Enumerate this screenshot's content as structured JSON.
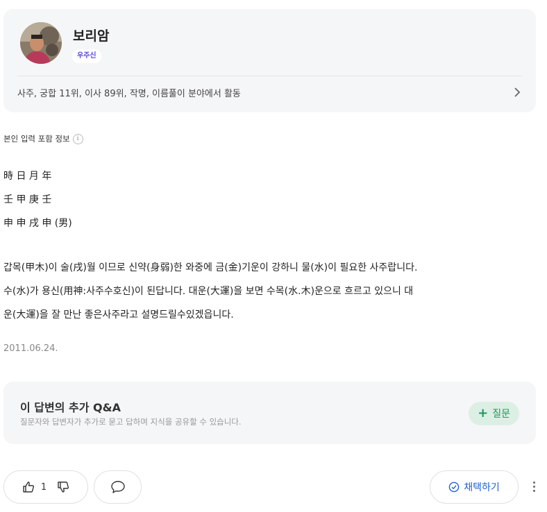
{
  "profile": {
    "name": "보리암",
    "grade_badge": "우주신",
    "description": "사주, 궁합 11위, 이사 89위, 작명, 이름풀이 분야에서 활동"
  },
  "answer": {
    "info_label": "본인 입력 포함 정보",
    "info_icon_glyph": "i",
    "lines": [
      "時 日 月 年",
      "壬 甲 庚 壬",
      "申 申 戌 申 (男)"
    ],
    "paragraph": [
      "갑목(甲木)이 술(戌)월 이므로 신약(身弱)한 와중에 금(金)기운이 강하니 물(水)이 필요한 사주랍니다.",
      "수(水)가 용신(用神:사주수호신)이 된답니다. 대운(大運)을 보면 수목(水.木)운으로 흐르고 있으니 대",
      "운(大運)을 잘 만난 좋은사주라고 설명드릴수있겠읍니다."
    ],
    "date": "2011.06.24."
  },
  "qa": {
    "title": "이 답변의 추가 Q&A",
    "subtitle": "질문자와 답변자가 추가로 묻고 답하며 지식을 공유할 수 있습니다.",
    "button_label": "질문",
    "button_icon": "plus-icon"
  },
  "actions": {
    "like_count": "1",
    "adopt_label": "채택하기"
  },
  "colors": {
    "card_bg": "#f5f6f8",
    "badge_text": "#5b4bd6",
    "qa_button_bg": "#dcefe5",
    "qa_button_text": "#1a9a5a",
    "adopt_text": "#1f5fd6"
  }
}
